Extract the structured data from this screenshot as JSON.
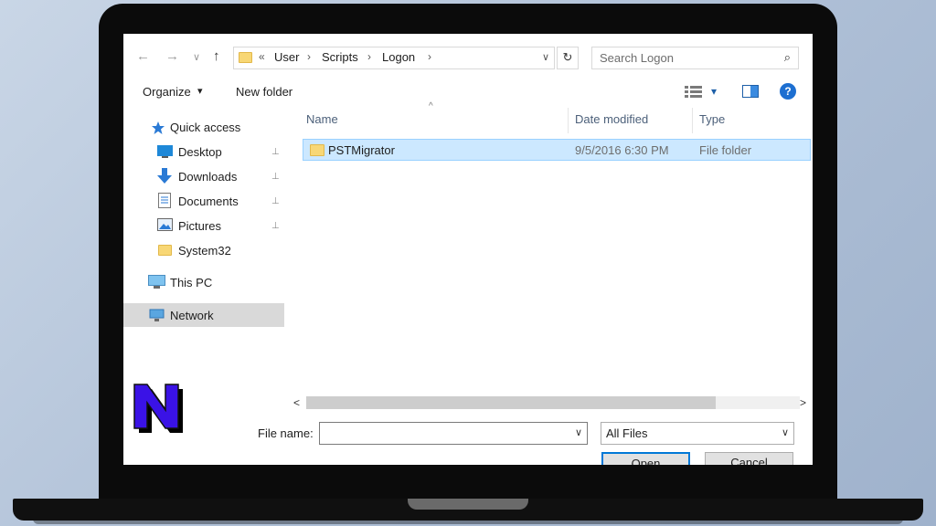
{
  "nav": {
    "back": "←",
    "forward": "→",
    "recent": "∨",
    "up": "↑"
  },
  "address": {
    "overflow": "«",
    "segments": [
      "User",
      "Scripts",
      "Logon"
    ],
    "separator": "›",
    "dropdown": "∨",
    "refresh": "↻"
  },
  "search": {
    "placeholder": "Search Logon",
    "icon": "⌕"
  },
  "toolbar": {
    "organize": "Organize",
    "organize_caret": "▾",
    "new_folder": "New folder",
    "view_caret": "▾",
    "help": "?"
  },
  "sidebar": {
    "quick_access": "Quick access",
    "items": [
      {
        "label": "Desktop",
        "pinned": true
      },
      {
        "label": "Downloads",
        "pinned": true
      },
      {
        "label": "Documents",
        "pinned": true
      },
      {
        "label": "Pictures",
        "pinned": true
      },
      {
        "label": "System32",
        "pinned": false
      }
    ],
    "this_pc": "This PC",
    "network": "Network",
    "pin_glyph": "📌"
  },
  "columns": {
    "name": "Name",
    "date_modified": "Date modified",
    "type": "Type",
    "sort_glyph": "^"
  },
  "files": [
    {
      "name": "PSTMigrator",
      "date_modified": "9/5/2016 6:30 PM",
      "type": "File folder"
    }
  ],
  "scroll": {
    "left": "<",
    "right": ">"
  },
  "footer": {
    "file_name_label": "File name:",
    "file_name_value": "",
    "file_name_caret": "∨",
    "filter": "All Files",
    "filter_caret": "∨",
    "open": "Open",
    "cancel": "Cancel"
  },
  "colors": {
    "selection": "#cce8ff",
    "selection_border": "#99d1ff",
    "accent": "#0078d7",
    "header_text": "#4c607a",
    "logo_fill": "#3a12e6"
  }
}
